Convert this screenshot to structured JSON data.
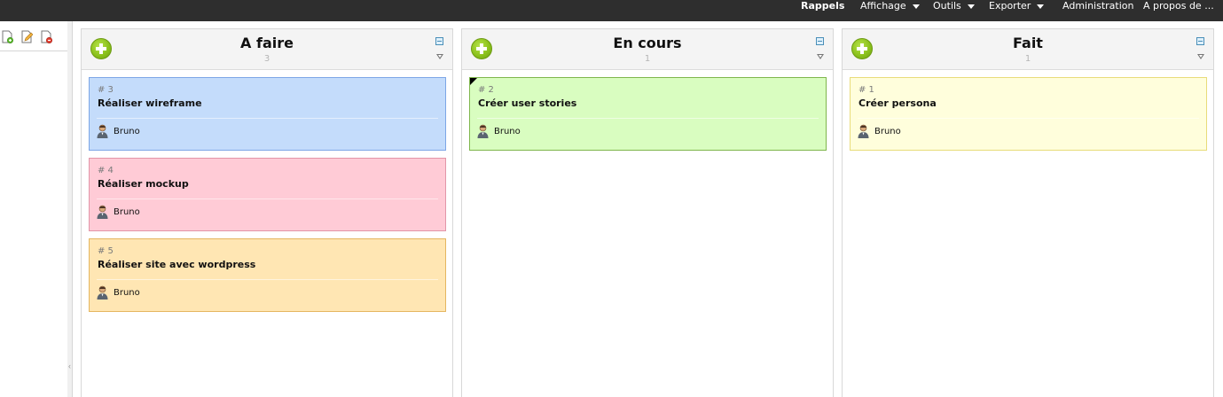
{
  "menubar": {
    "items": [
      {
        "label": "Rappels",
        "bold": true,
        "dropdown": false
      },
      {
        "label": "Affichage",
        "bold": false,
        "dropdown": true
      },
      {
        "label": "Outils",
        "bold": false,
        "dropdown": true
      },
      {
        "label": "Exporter",
        "bold": false,
        "dropdown": true
      },
      {
        "label": "Administration",
        "bold": false,
        "dropdown": false
      },
      {
        "label": "A propos de ...",
        "bold": false,
        "dropdown": false
      }
    ]
  },
  "toolbar": {
    "icons": [
      "new-document-icon",
      "edit-document-icon",
      "delete-document-icon"
    ]
  },
  "columns": [
    {
      "title": "A faire",
      "count": "3",
      "cards": [
        {
          "id": "# 3",
          "title": "Réaliser wireframe",
          "owner": "Bruno",
          "color": "#c4dcfb",
          "border": "#7da6e6",
          "flag": false
        },
        {
          "id": "# 4",
          "title": "Réaliser mockup",
          "owner": "Bruno",
          "color": "#ffcbd6",
          "border": "#e295a8",
          "flag": false
        },
        {
          "id": "# 5",
          "title": "Réaliser site avec wordpress",
          "owner": "Bruno",
          "color": "#ffe6b3",
          "border": "#e5b660",
          "flag": false
        }
      ]
    },
    {
      "title": "En cours",
      "count": "1",
      "cards": [
        {
          "id": "# 2",
          "title": "Créer user stories",
          "owner": "Bruno",
          "color": "#d9fdc0",
          "border": "#7fb64c",
          "flag": true
        }
      ]
    },
    {
      "title": "Fait",
      "count": "1",
      "cards": [
        {
          "id": "# 1",
          "title": "Créer persona",
          "owner": "Bruno",
          "color": "#fffedc",
          "border": "#e8dc7a",
          "flag": false
        }
      ]
    }
  ]
}
